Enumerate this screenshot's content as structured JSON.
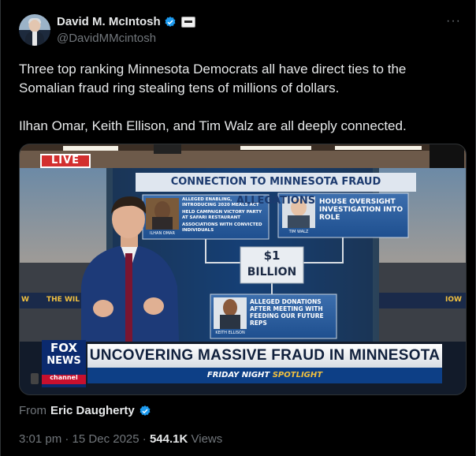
{
  "author": {
    "name": "David M. McIntosh",
    "handle": "@DavidMMcintosh"
  },
  "post": {
    "paragraphs": [
      "Three top ranking Minnesota Democrats all have direct ties to the Somalian fraud ring stealing tens of millions of dollars.",
      "Ilhan Omar, Keith Ellison, and Tim Walz are all deeply connected."
    ]
  },
  "media": {
    "live_badge": "LIVE",
    "board_title": "CONNECTION TO MINNESOTA FRAUD ALLEGATIONS",
    "omar": {
      "caption": "ILHAN OMAR",
      "bullets": [
        "ALLEGED ENABLING, INTRODUCING 2020 MEALS ACT",
        "HELD CAMPAIGN VICTORY PARTY AT SAFARI RESTAURANT",
        "ASSOCIATIONS WITH CONVICTED INDIVIDUALS"
      ]
    },
    "walz": {
      "caption": "TIM WALZ",
      "text": "HOUSE OVERSIGHT INVESTIGATION INTO ROLE"
    },
    "center_amount": "$1",
    "center_unit": "BILLION",
    "ellison": {
      "caption": "KEITH ELLISON",
      "text": "ALLEGED DONATIONS AFTER MEETING WITH FEEDING OUR FUTURE REPS"
    },
    "side_left": "THE WIL",
    "side_left_2": "W",
    "side_right": "IOW",
    "logo_line1": "FOX",
    "logo_line2": "NEWS",
    "logo_line3": "channel",
    "chyron": "UNCOVERING MASSIVE FRAUD IN MINNESOTA",
    "show_prefix": "FRIDAY NIGHT",
    "show_suffix": "SPOTLIGHT"
  },
  "attribution": {
    "prefix": "From",
    "source": "Eric Daugherty"
  },
  "meta": {
    "time": "3:01 pm",
    "separator": " · ",
    "date": "15 Dec 2025",
    "views_count": "544.1K",
    "views_label": " Views"
  },
  "colors": {
    "verified": "#1d9bf0",
    "live_red": "#d32f2f",
    "board_navy": "#1c3a6e"
  }
}
